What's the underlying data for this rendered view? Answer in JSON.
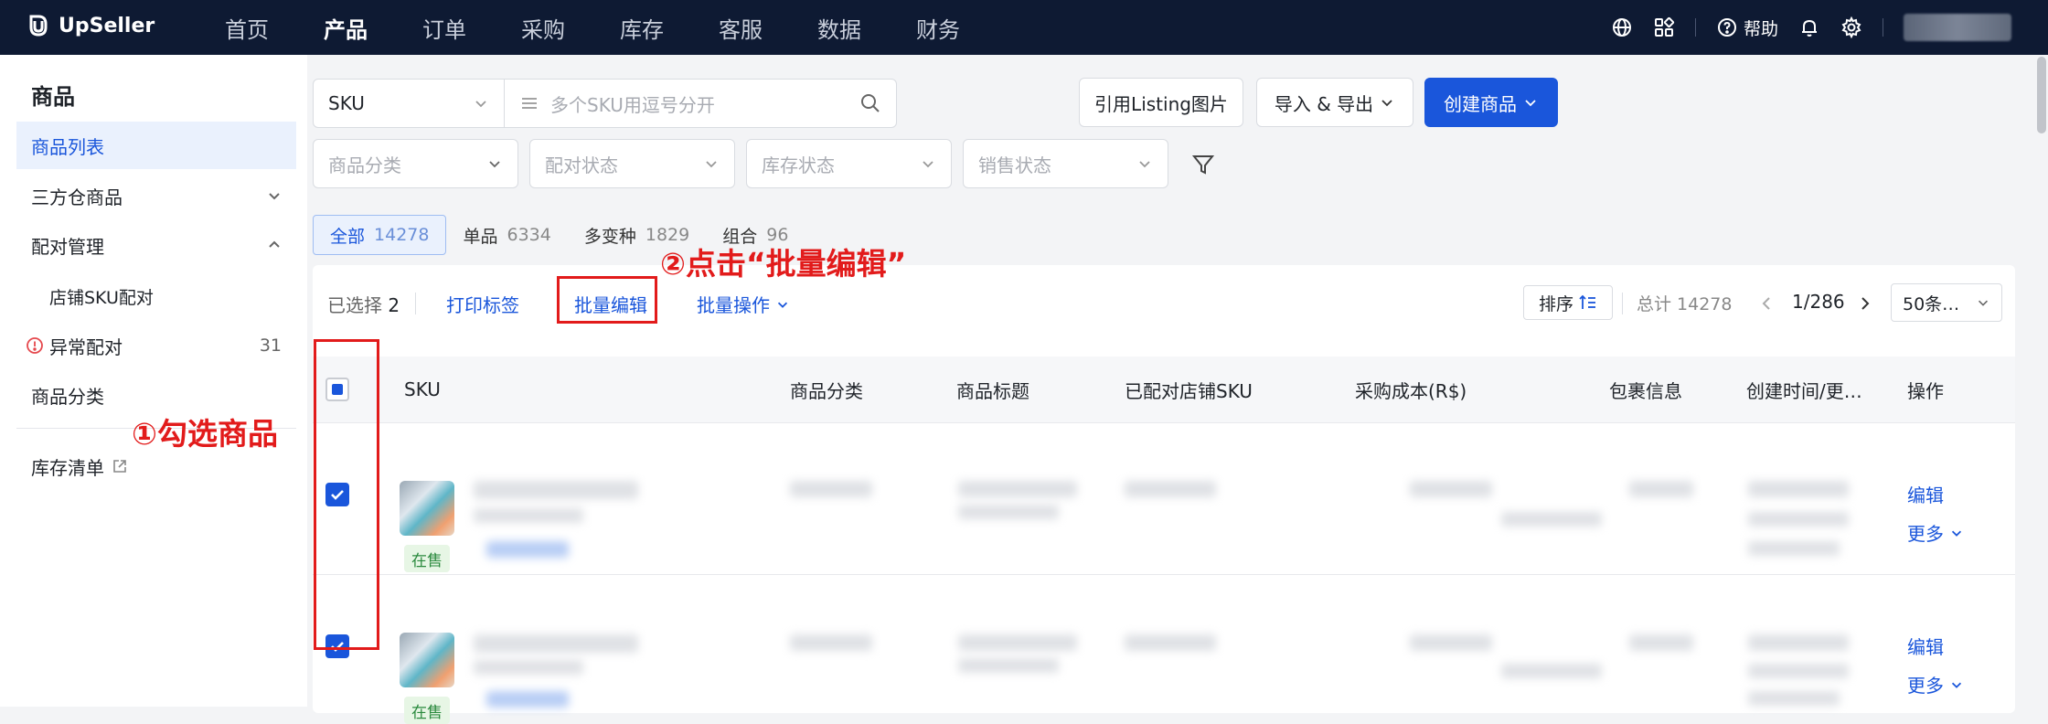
{
  "app": {
    "logo_text": "UpSeller"
  },
  "nav": {
    "items": [
      "首页",
      "产品",
      "订单",
      "采购",
      "库存",
      "客服",
      "数据",
      "财务"
    ],
    "active_index": 1,
    "help": "帮助"
  },
  "sidebar": {
    "title": "商品",
    "items": [
      {
        "label": "商品列表"
      },
      {
        "label": "三方仓商品"
      },
      {
        "label": "配对管理"
      },
      {
        "label": "店铺SKU配对"
      },
      {
        "label": "异常配对",
        "count": "31"
      },
      {
        "label": "商品分类"
      },
      {
        "label": "库存清单"
      }
    ]
  },
  "search": {
    "type": "SKU",
    "placeholder": "多个SKU用逗号分开"
  },
  "filters": [
    "商品分类",
    "配对状态",
    "库存状态",
    "销售状态"
  ],
  "actions": {
    "listing_image": "引用Listing图片",
    "import_export": "导入 & 导出",
    "create": "创建商品"
  },
  "tabs": [
    {
      "label": "全部",
      "count": "14278"
    },
    {
      "label": "单品",
      "count": "6334"
    },
    {
      "label": "多变种",
      "count": "1829"
    },
    {
      "label": "组合",
      "count": "96"
    }
  ],
  "toolbar": {
    "selected_label": "已选择",
    "selected_count": "2",
    "print": "打印标签",
    "bulk_edit": "批量编辑",
    "bulk_ops": "批量操作",
    "sort": "排序",
    "total": "总计 14278",
    "page": "1/286",
    "page_size": "50条…"
  },
  "table": {
    "columns": [
      "SKU",
      "商品分类",
      "商品标题",
      "已配对店铺SKU",
      "采购成本(R$)",
      "包裹信息",
      "创建时间/更…",
      "操作"
    ],
    "rows": [
      {
        "status": "在售",
        "edit": "编辑",
        "more": "更多"
      },
      {
        "status": "在售",
        "edit": "编辑",
        "more": "更多"
      }
    ]
  },
  "annotations": {
    "step1": "①勾选商品",
    "step2": "②点击“批量编辑”"
  },
  "colors": {
    "brand": "#1a56db",
    "nav_bg": "#0e1a33",
    "annotation": "#e21b1b"
  }
}
